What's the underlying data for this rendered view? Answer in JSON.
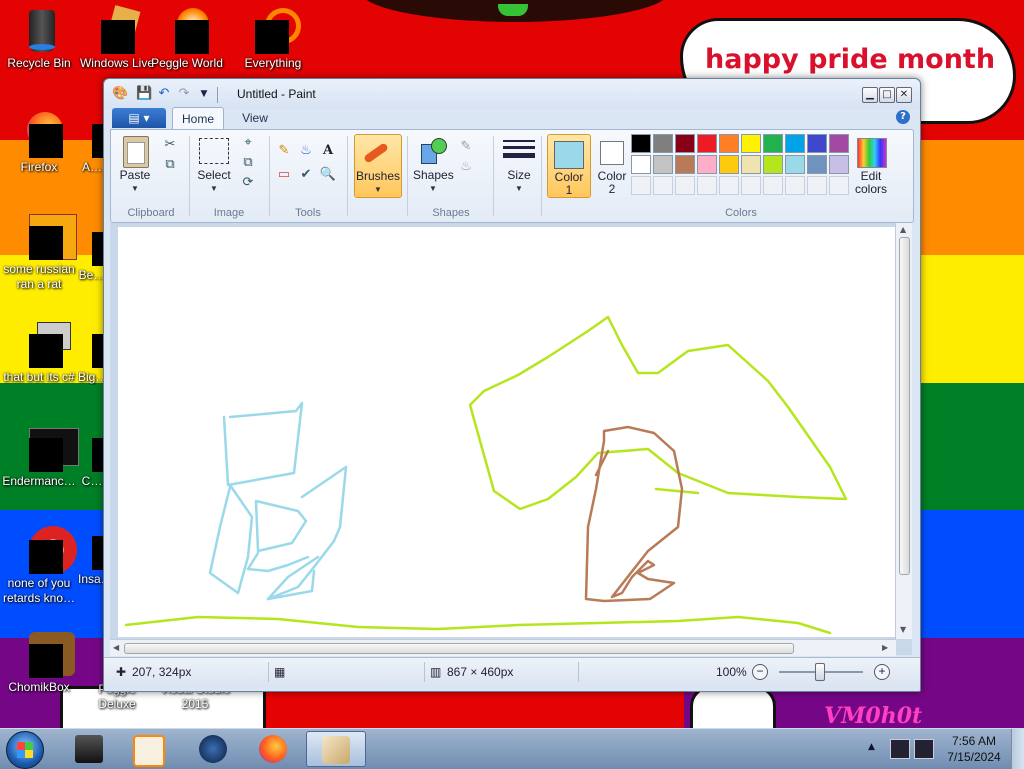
{
  "desktop": {
    "bubble_text": "happy pride month",
    "signature": "VM0h0t",
    "icons": [
      {
        "label": "Recycle Bin"
      },
      {
        "label": "Windows Live"
      },
      {
        "label": "Peggle World"
      },
      {
        "label": "Everything"
      },
      {
        "label": "Firefox"
      },
      {
        "label": "A…"
      },
      {
        "label": "some russian ran a rat"
      },
      {
        "label": "Be…"
      },
      {
        "label": "that but its c#"
      },
      {
        "label": "Big…"
      },
      {
        "label": "Endermanc…"
      },
      {
        "label": "C…"
      },
      {
        "label": "none of you retards kno…"
      },
      {
        "label": "Insa…"
      },
      {
        "label": "ChomikBox"
      },
      {
        "label": "Peggle Deluxe"
      },
      {
        "label": "Visual Studio 2015"
      }
    ]
  },
  "paint": {
    "title": "Untitled - Paint",
    "tabs": {
      "home": "Home",
      "view": "View"
    },
    "clipboard": {
      "paste": "Paste",
      "group": "Clipboard"
    },
    "image": {
      "select": "Select",
      "group": "Image"
    },
    "tools": {
      "group": "Tools"
    },
    "brushes": {
      "label": "Brushes"
    },
    "shapes": {
      "label": "Shapes",
      "group": "Shapes"
    },
    "size": {
      "label": "Size"
    },
    "colors": {
      "color1_label": "Color",
      "color1_num": "1",
      "color2_label": "Color",
      "color2_num": "2",
      "edit_label": "Edit",
      "edit_label2": "colors",
      "group": "Colors",
      "color1": "#99d9ea",
      "color2": "#ffffff",
      "palette_row1": [
        "#000000",
        "#7f7f7f",
        "#880015",
        "#ed1c24",
        "#ff7f27",
        "#fff200",
        "#22b14c",
        "#00a2e8",
        "#3f48cc",
        "#a349a4"
      ],
      "palette_row2": [
        "#ffffff",
        "#c3c3c3",
        "#b97a57",
        "#ffaec9",
        "#ffc90e",
        "#efe4b0",
        "#b5e61d",
        "#99d9ea",
        "#7092be",
        "#c8bfe7"
      ]
    },
    "status": {
      "cursor_pos": "207, 324px",
      "canvas_size": "867 × 460px",
      "zoom": "100%"
    }
  },
  "taskbar": {
    "time": "7:56 AM",
    "date": "7/15/2024"
  }
}
